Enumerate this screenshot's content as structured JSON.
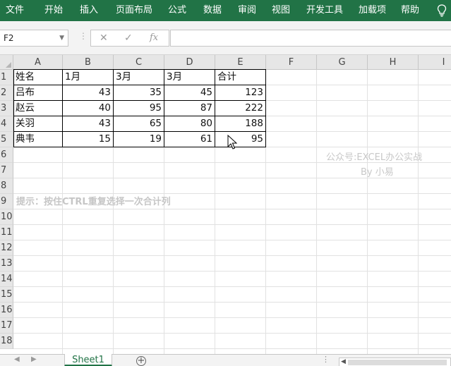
{
  "ribbon": {
    "tabs": [
      "文件",
      "开始",
      "插入",
      "页面布局",
      "公式",
      "数据",
      "审阅",
      "视图",
      "开发工具",
      "加载项",
      "帮助"
    ],
    "help_icon": "lightbulb-icon"
  },
  "formula_bar": {
    "name_box": "F2",
    "cancel_icon": "✕",
    "enter_icon": "✓",
    "fx_label": "fx",
    "formula": ""
  },
  "grid": {
    "columns": [
      "A",
      "B",
      "C",
      "D",
      "E",
      "F",
      "G",
      "H",
      "I"
    ],
    "rows": [
      "1",
      "2",
      "3",
      "4",
      "5",
      "6",
      "7",
      "8",
      "9",
      "10",
      "11",
      "12",
      "13",
      "14",
      "15",
      "16",
      "17",
      "18"
    ],
    "table": {
      "header": [
        "姓名",
        "1月",
        "3月",
        "3月",
        "合计"
      ],
      "rows": [
        [
          "吕布",
          "43",
          "35",
          "45",
          "123"
        ],
        [
          "赵云",
          "40",
          "95",
          "87",
          "222"
        ],
        [
          "关羽",
          "43",
          "65",
          "80",
          "188"
        ],
        [
          "典韦",
          "15",
          "19",
          "61",
          "95"
        ]
      ]
    },
    "watermark_line1": "公众号:EXCEL办公实战",
    "watermark_line2": "By 小易",
    "hint": "提示：按住CTRL重复选择一次合计列"
  },
  "sheets": {
    "nav_prev": "◀",
    "nav_next": "▶",
    "active_tab": "Sheet1",
    "add_label": "+",
    "dots": "⋮"
  },
  "colors": {
    "ribbon_bg": "#217346",
    "accent": "#217346"
  }
}
